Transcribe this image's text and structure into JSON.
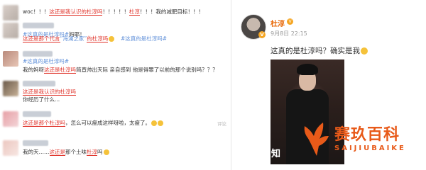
{
  "comments": [
    {
      "segments": [
        {
          "t": "woc！！！",
          "c": "n"
        },
        {
          "t": "这还是我认识的杜淳吗",
          "c": "r"
        },
        {
          "t": "！！！！！",
          "c": "n"
        },
        {
          "t": "杜淳",
          "c": "r"
        },
        {
          "t": "！！！我的减肥目标！！！",
          "c": "n"
        }
      ]
    },
    {
      "segments": [
        {
          "t": "#这真的是杜淳吗#",
          "c": "tag"
        },
        {
          "t": "妈耶！",
          "c": "n"
        }
      ]
    },
    {
      "segments": [
        {
          "t": "#这真的是杜淳吗#",
          "c": "tag"
        },
        {
          "t": "这还是那个代言",
          "c": "r"
        },
        {
          "t": "“海澜之家”",
          "c": "tag"
        },
        {
          "t": "的杜淳吗",
          "c": "r"
        }
      ]
    },
    {
      "segments": [
        {
          "t": "#这真的是杜淳吗#",
          "c": "tag"
        }
      ]
    },
    {
      "segments": [
        {
          "t": "我的妈呀",
          "c": "n"
        },
        {
          "t": "这还是杜淳吗",
          "c": "r"
        },
        {
          "t": "简直帅出天际 亲自感到 他是得罪了以前的那个说别吗？？？",
          "c": "n"
        }
      ]
    },
    {
      "segments": [
        {
          "t": "这还是我认识的杜淳吗",
          "c": "r"
        }
      ]
    },
    {
      "segments": [
        {
          "t": "你经历了什么...",
          "c": "n"
        }
      ]
    },
    {
      "segments": [
        {
          "t": "这还是那个",
          "c": "r"
        },
        {
          "t": "杜淳吗",
          "c": "r"
        },
        {
          "t": "，怎么可以瘦成这样呀啦，太瘦了。",
          "c": "n"
        }
      ]
    },
    {
      "segments": [
        {
          "t": "我的天……",
          "c": "n"
        },
        {
          "t": "这还是",
          "c": "r"
        },
        {
          "t": "那个土味",
          "c": "n"
        },
        {
          "t": "杜淳",
          "c": "r"
        },
        {
          "t": "吗",
          "c": "n"
        }
      ]
    }
  ],
  "comment_meta": {
    "reply": "评论",
    "like": "赞"
  },
  "post": {
    "author": "杜淳",
    "verified": "V",
    "time": "9月8日 22:15",
    "text": "这真的是杜淳吗？确实是我",
    "photo_caption": "知"
  },
  "watermark": {
    "cn": "赛玖百科",
    "en": "SAIJIUBAIKE"
  },
  "colors": {
    "accent": "#e0332a",
    "tag": "#5d8ed8",
    "brand": "#e85a19",
    "author": "#e86b0c"
  }
}
